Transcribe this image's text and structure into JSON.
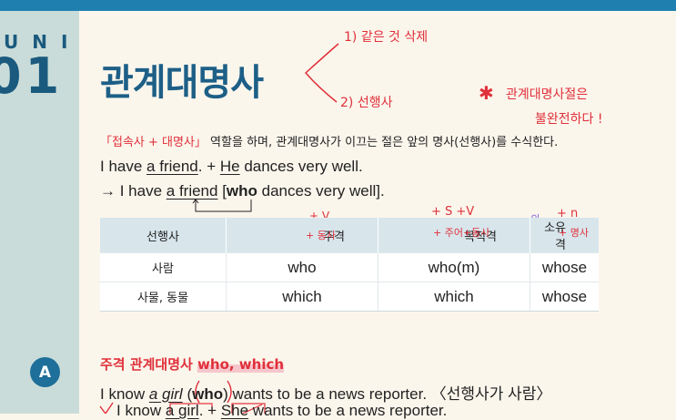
{
  "unit": {
    "word": "UNIT",
    "number": "01"
  },
  "title": "관계대명사",
  "annotations": {
    "note_1": "1) 같은 것 삭제",
    "note_2": "2) 선행사",
    "note_3_line1": "관계대명사절은",
    "note_3_line2": "불완전하다 !",
    "star": "✱",
    "subject_v": "+ V",
    "subject_verb": "+ 동사",
    "object_sv": "+ S +V",
    "object_subj_verb": "+ 주어+동사",
    "possessive_of": "~의",
    "possessive_n": "+ n",
    "possessive_noun": "+ 명사"
  },
  "intro": {
    "highlight": "「접속사 + 대명사」",
    "rest": " 역할을 하며, 관계대명사가 이끄는 절은 앞의 명사(선행사)를 수식한다."
  },
  "example1": {
    "a": "I have ",
    "b": "a friend",
    "c": ". + ",
    "d": "He",
    "e": " dances very well."
  },
  "example2": {
    "arrow": "→",
    "a": " I have ",
    "b": "a friend",
    "c": " [",
    "d": "who",
    "e": " dances very well]."
  },
  "table": {
    "headers": [
      "선행사",
      "주격",
      "목적격",
      "소유격"
    ],
    "rows": [
      [
        "사람",
        "who",
        "who(m)",
        "whose"
      ],
      [
        "사물, 동물",
        "which",
        "which",
        "whose"
      ]
    ]
  },
  "section": {
    "badge": "A",
    "title_ko": "주격 관계대명사 ",
    "title_en": "who, which"
  },
  "example3": {
    "a": "I know ",
    "b": "a girl",
    "c": " (",
    "d": "who",
    "e": ") wants to be a news reporter. 〈선행사가 사람〉"
  },
  "example4": {
    "a": "I know ",
    "b": "a girl",
    "c": ". + ",
    "d": "She",
    "e": " wants to be a news reporter."
  }
}
